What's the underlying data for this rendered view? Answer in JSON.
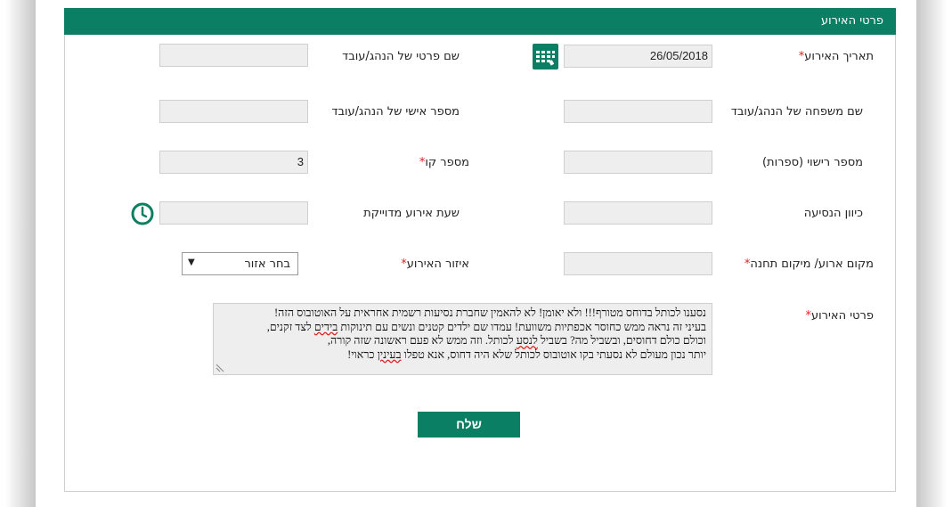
{
  "section_title": "פרטי האירוע",
  "fields": {
    "event_date": {
      "label": "תאריך האירוע",
      "value": "26/05/2018"
    },
    "driver_first_name": {
      "label": "שם פרטי של הנהג/עובד",
      "value": ""
    },
    "driver_last_name": {
      "label": "שם משפחה של הנהג/עובד",
      "value": ""
    },
    "driver_id": {
      "label": "מספר אישי של הנהג/עובד",
      "value": ""
    },
    "license_number": {
      "label": "מספר רישוי (ספרות)",
      "value": ""
    },
    "line_number": {
      "label": "מספר קו",
      "value": "3"
    },
    "direction": {
      "label": "כיוון הנסיעה",
      "value": ""
    },
    "exact_time": {
      "label": "שעת אירוע מדוייקת",
      "value": ""
    },
    "location": {
      "label": "מקום ארוע/ מיקום תחנה",
      "value": ""
    },
    "area": {
      "label": "איזור האירוע",
      "value": "בחר אזור"
    },
    "details": {
      "label": "פרטי האירוע",
      "lines": [
        "נסענו לכותל בדוחס מטורף!!! ולא יאומן! לא להאמין שחברת נסיעות רשמית אחראית על האוטובוס הזה!",
        "בעיני זה נראה ממש כחוסר אכפתיות משוועת! עמדו שם ילדים קטנים ונשים עם תינוקות",
        "וכולם כולם דחוסים, ובשביל מה? בשביל",
        "יותר נכון מעולם לא נסעתי בקו אוטובוס לכותל שלא היה דחוס, אנא טפלו"
      ],
      "segments": {
        "line2_word": "בידים",
        "line2_tail": "לצד זקנים,",
        "line3_word": "לנסע",
        "line3_tail": "לכותל. וזה ממש לא פעם ראשונה שזה קורה,",
        "line4_word": "בעינין",
        "line4_tail": "כראוי!"
      }
    }
  },
  "submit_label": "שלח",
  "required_mark": "*",
  "icons": {
    "calendar": "calendar-icon",
    "clock": "clock-icon",
    "dropdown": "chevron-down-icon"
  },
  "colors": {
    "brand_green": "#0a7f63",
    "required_red": "#dd2222",
    "input_bg": "#eeeeee"
  }
}
